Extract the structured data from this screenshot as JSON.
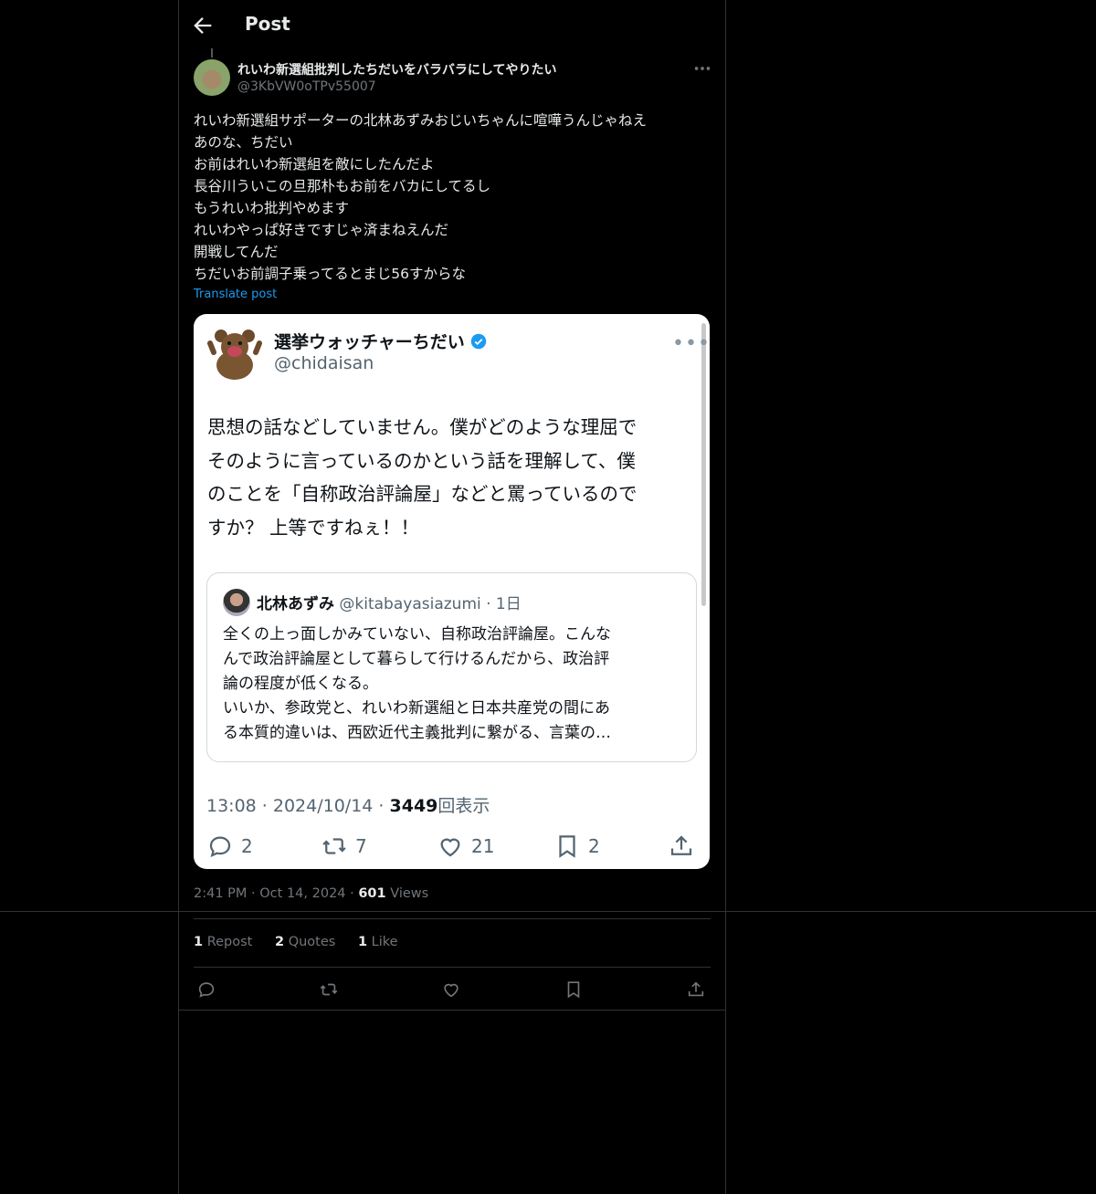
{
  "header": {
    "title": "Post"
  },
  "author": {
    "name": "れいわ新選組批判したちだいをバラバラにしてやりたい",
    "handle": "@3KbVW0oTPv55007"
  },
  "post": {
    "lines": [
      "れいわ新選組サポーターの北林あずみおじいちゃんに喧嘩うんじゃねえ",
      "あのな、ちだい",
      "お前はれいわ新選組を敵にしたんだよ",
      "長谷川ういこの旦那朴もお前をバカにしてるし",
      "もうれいわ批判やめます",
      "れいわやっぱ好きですじゃ済まねえんだ",
      "開戦してんだ",
      "ちだいお前調子乗ってるとまじ56すからな"
    ],
    "translate_label": "Translate post"
  },
  "screenshot": {
    "name": "選挙ウォッチャーちだい",
    "handle": "@chidaisan",
    "text_lines": [
      "思想の話などしていません。僕がどのような理屈で",
      "そのように言っているのかという話を理解して、僕",
      "のことを「自称政治評論屋」などと罵っているので",
      "すか？ 上等ですねぇ！！"
    ],
    "quoted": {
      "name": "北林あずみ",
      "handle_time": "@kitabayasiazumi · 1日",
      "text_lines": [
        "全くの上っ面しかみていない、自称政治評論屋。こんな",
        "んで政治評論屋として暮らして行けるんだから、政治評",
        "論の程度が低くなる。",
        "いいか、参政党と、れいわ新選組と日本共産党の間にあ",
        "る本質的違いは、西欧近代主義批判に繋がる、言葉の…"
      ]
    },
    "meta_prefix": "13:08 · 2024/10/14 · ",
    "views_count": "3449",
    "views_label": "回表示",
    "stats": {
      "replies": "2",
      "reposts": "7",
      "likes": "21",
      "bookmarks": "2"
    }
  },
  "meta": {
    "time": "2:41 PM",
    "dot1": "·",
    "date": "Oct 14, 2024",
    "dot2": "·",
    "views_count": "601",
    "views_label": "Views"
  },
  "engagement": {
    "reposts_count": "1",
    "reposts_label": "Repost",
    "quotes_count": "2",
    "quotes_label": "Quotes",
    "likes_count": "1",
    "likes_label": "Like"
  },
  "colors": {
    "background": "#000000",
    "accent": "#1d9bf0",
    "border": "#2f3336",
    "muted": "#71767b"
  }
}
